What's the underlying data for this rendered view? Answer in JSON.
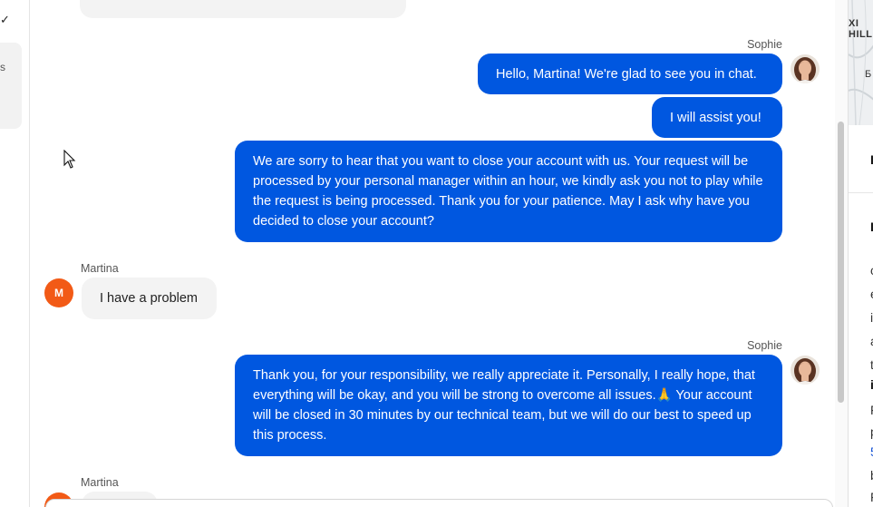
{
  "left_panel": {
    "check_glyph": "✓",
    "card_text": "s"
  },
  "messages": {
    "m1": {
      "sender": "Sophie",
      "text": "Hello, Martina! We're glad to see you in chat."
    },
    "m2": {
      "text": "I will assist you!"
    },
    "m3": {
      "text": "We are sorry to hear that you want to close your account with us. Your request will be processed by your personal manager within an hour, we kindly ask you not to play while the request is being processed. Thank you for your patience. May I ask why have you decided to close your account?"
    },
    "m4": {
      "sender": "Martina",
      "avatar_initial": "M",
      "text": "I have a problem"
    },
    "m5": {
      "sender": "Sophie",
      "text": "Thank you, for your responsibility, we really appreciate it. Personally, I really hope, that everything will be okay, and you will be strong to overcome all issues.🙏 Your account will be closed in 30 minutes by our technical team, but we will do our best to speed up this process."
    },
    "m6": {
      "sender": "Martina"
    }
  },
  "right_panel": {
    "map_labels": [
      "XI",
      "HILL",
      "Б"
    ],
    "chars": [
      "I",
      "I",
      "c",
      "e",
      "i",
      "a",
      "t",
      "i",
      "F",
      "p",
      "5",
      "b",
      "F"
    ]
  },
  "colors": {
    "agent_bubble": "#0057e0",
    "user_bubble": "#f3f3f3",
    "martina_avatar": "#f25a16"
  }
}
